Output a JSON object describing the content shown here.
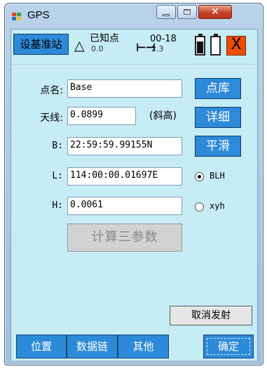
{
  "window": {
    "title": "GPS"
  },
  "toolbar": {
    "base_button": "设基准站",
    "known_label": "已知点",
    "known_value": "0.0",
    "diff_label": "00-18",
    "diff_value": "2.3",
    "close_symbol": "X"
  },
  "form": {
    "point_name_label": "点名:",
    "point_name_value": "Base",
    "antenna_label": "天线:",
    "antenna_value": "0.0899",
    "slope_text": "(斜高)",
    "b_label": "B:",
    "b_value": "22:59:59.99155N",
    "l_label": "L:",
    "l_value": "114:00:00.01697E",
    "h_label": "H:",
    "h_value": "0.0061"
  },
  "side_buttons": {
    "library": "点库",
    "detail": "详细",
    "smooth": "平滑"
  },
  "coord_mode": {
    "options": [
      "BLH",
      "xyh"
    ],
    "selected": "BLH"
  },
  "buttons": {
    "calc": "计算三参数",
    "cancel_emit": "取消发射",
    "ok": "确定"
  },
  "tabs": [
    "位置",
    "数据链",
    "其他"
  ],
  "colors": {
    "client_bg": "#c6ecf5",
    "accent_blue": "#2d8ad8",
    "close_red": "#ee4d00"
  }
}
